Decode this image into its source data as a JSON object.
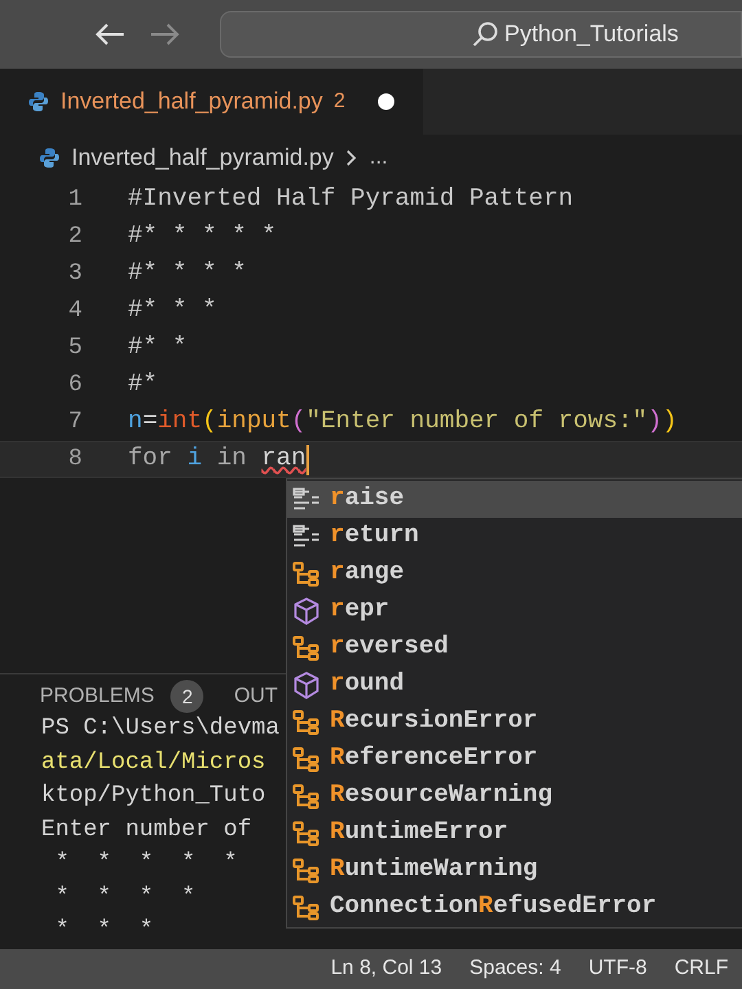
{
  "title_bar": {
    "search": "Python_Tutorials"
  },
  "tab": {
    "filename": "Inverted_half_pyramid.py",
    "problems": "2",
    "dirty": true
  },
  "breadcrumb": {
    "file": "Inverted_half_pyramid.py",
    "more": "..."
  },
  "code_lines": [
    {
      "number": "1",
      "current": false,
      "tokens": [
        {
          "text": "#Inverted Half Pyramid Pattern",
          "kind": "comment"
        }
      ]
    },
    {
      "number": "2",
      "current": false,
      "tokens": [
        {
          "text": "#* * * * *",
          "kind": "comment"
        }
      ]
    },
    {
      "number": "3",
      "current": false,
      "tokens": [
        {
          "text": "#* * * *",
          "kind": "comment"
        }
      ]
    },
    {
      "number": "4",
      "current": false,
      "tokens": [
        {
          "text": "#* * *",
          "kind": "comment"
        }
      ]
    },
    {
      "number": "5",
      "current": false,
      "tokens": [
        {
          "text": "#* *",
          "kind": "comment"
        }
      ]
    },
    {
      "number": "6",
      "current": false,
      "tokens": [
        {
          "text": "#*",
          "kind": "comment"
        }
      ]
    },
    {
      "number": "7",
      "current": false,
      "tokens": [
        {
          "text": "n",
          "kind": "variable"
        },
        {
          "text": "=",
          "kind": "plain"
        },
        {
          "text": "int",
          "kind": "builtin"
        },
        {
          "text": "(",
          "kind": "bracket1"
        },
        {
          "text": "input",
          "kind": "function"
        },
        {
          "text": "(",
          "kind": "bracket2"
        },
        {
          "text": "\"Enter number of rows:\"",
          "kind": "string"
        },
        {
          "text": ")",
          "kind": "bracket2"
        },
        {
          "text": ")",
          "kind": "bracket1"
        }
      ]
    },
    {
      "number": "8",
      "current": true,
      "tokens": [
        {
          "text": "for ",
          "kind": "keyword"
        },
        {
          "text": "i",
          "kind": "variable"
        },
        {
          "text": " in ",
          "kind": "keyword"
        },
        {
          "text": "ran",
          "kind": "error"
        }
      ]
    }
  ],
  "panel": {
    "tabs": [
      {
        "label": "PROBLEMS",
        "badge": "2"
      },
      {
        "label": "OUT"
      }
    ],
    "terminal": [
      {
        "text": "PS C:\\Users\\devma",
        "kind": "plain"
      },
      {
        "text": "ata/Local/Micros",
        "kind": "path"
      },
      {
        "text": "ktop/Python_Tuto",
        "kind": "plain"
      },
      {
        "text": "Enter number of",
        "kind": "plain"
      },
      {
        "text": " *  *  *  *  *",
        "kind": "plain"
      },
      {
        "text": " *  *  *  *",
        "kind": "plain"
      },
      {
        "text": " *  *  *",
        "kind": "plain"
      }
    ]
  },
  "suggestions": [
    {
      "kind": "keyword",
      "match": "r",
      "after": "aise",
      "selected": true
    },
    {
      "kind": "keyword",
      "match": "r",
      "after": "eturn",
      "selected": false
    },
    {
      "kind": "class",
      "match": "r",
      "after": "ange",
      "selected": false
    },
    {
      "kind": "function",
      "match": "r",
      "after": "epr",
      "selected": false
    },
    {
      "kind": "class",
      "match": "r",
      "after": "eversed",
      "selected": false
    },
    {
      "kind": "function",
      "match": "r",
      "after": "ound",
      "selected": false
    },
    {
      "kind": "class",
      "match": "R",
      "after": "ecursionError",
      "selected": false
    },
    {
      "kind": "class",
      "match": "R",
      "after": "eferenceError",
      "selected": false
    },
    {
      "kind": "class",
      "match": "R",
      "after": "esourceWarning",
      "selected": false
    },
    {
      "kind": "class",
      "match": "R",
      "after": "untimeError",
      "selected": false
    },
    {
      "kind": "class",
      "match": "R",
      "after": "untimeWarning",
      "selected": false
    },
    {
      "kind": "class",
      "before": "Connection",
      "match": "R",
      "after": "efusedError",
      "selected": false
    }
  ],
  "status_bar": [
    "Ln 8, Col 13",
    "Spaces: 4",
    "UTF-8",
    "CRLF"
  ]
}
